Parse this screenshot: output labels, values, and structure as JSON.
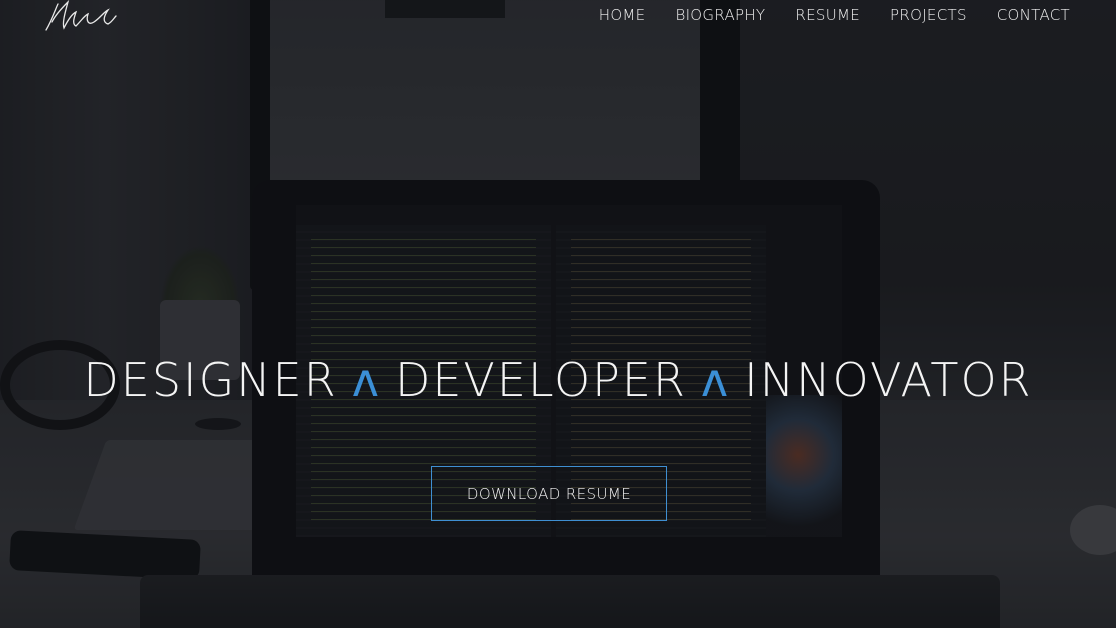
{
  "nav": {
    "items": [
      {
        "label": "HOME"
      },
      {
        "label": "BIOGRAPHY"
      },
      {
        "label": "RESUME"
      },
      {
        "label": "PROJECTS"
      },
      {
        "label": "CONTACT"
      }
    ]
  },
  "hero": {
    "words": [
      "DESIGNER",
      "DEVELOPER",
      "INNOVATOR"
    ],
    "separator": "ʌ",
    "separator_color": "#3b8fd6",
    "cta_label": "DOWNLOAD RESUME",
    "cta_border_color": "#3f8fd2"
  },
  "logo": {
    "icon": "signature-logo-icon"
  }
}
